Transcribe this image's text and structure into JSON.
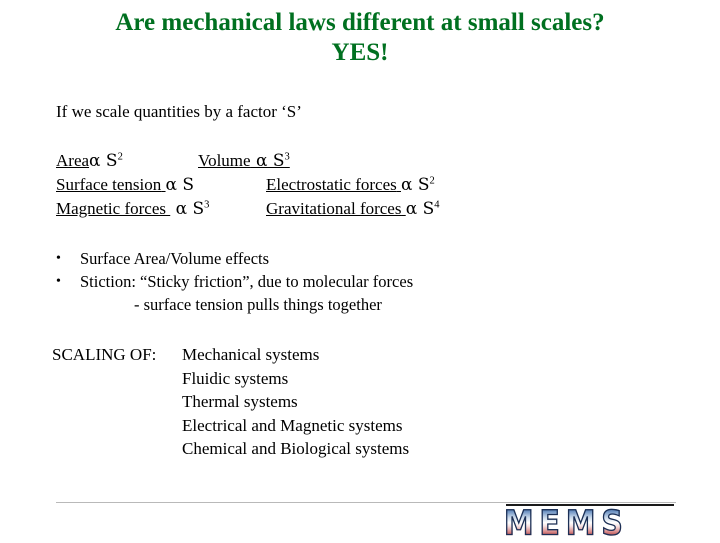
{
  "slide": {
    "title": {
      "line1": "Are mechanical laws different at small scales?",
      "line2": "YES!",
      "color": "#007020"
    },
    "intro": "If we scale quantities by a factor ‘S’",
    "scaling_relations": [
      {
        "left": {
          "quantity": "Area",
          "relation": "α S",
          "exponent": "2",
          "underline": "quantity"
        },
        "right": {
          "quantity": "Volume",
          "relation": "α S",
          "exponent": "3",
          "underline": "all"
        }
      },
      {
        "left": {
          "quantity": "Surface tension",
          "relation": "α  S",
          "exponent": "",
          "underline": "quantity"
        },
        "right": {
          "quantity": "Electrostatic forces",
          "relation": "α S",
          "exponent": "2",
          "underline": "quantity"
        }
      },
      {
        "left": {
          "quantity": "Magnetic forces",
          "relation": "α S",
          "exponent": "3",
          "underline": "quantity"
        },
        "right": {
          "quantity": "Gravitational forces",
          "relation": "α S",
          "exponent": "4",
          "underline": "quantity"
        }
      }
    ],
    "bullets": [
      {
        "marker": "•",
        "text": "Surface Area/Volume effects"
      },
      {
        "marker": "•",
        "text": "Stiction: “Sticky friction”, due to molecular forces"
      }
    ],
    "bullet_subline": "- surface tension pulls things together",
    "scaling_of": {
      "label": "SCALING OF:",
      "items": [
        "Mechanical systems",
        "Fluidic systems",
        "Thermal systems",
        "Electrical and Magnetic systems",
        "Chemical and Biological systems"
      ]
    },
    "logo": {
      "text": "MEMS",
      "gradient_top": "#2c4f86",
      "gradient_mid": "#ffffff",
      "gradient_bottom": "#8e2222",
      "outline": "#1b2f55"
    }
  }
}
